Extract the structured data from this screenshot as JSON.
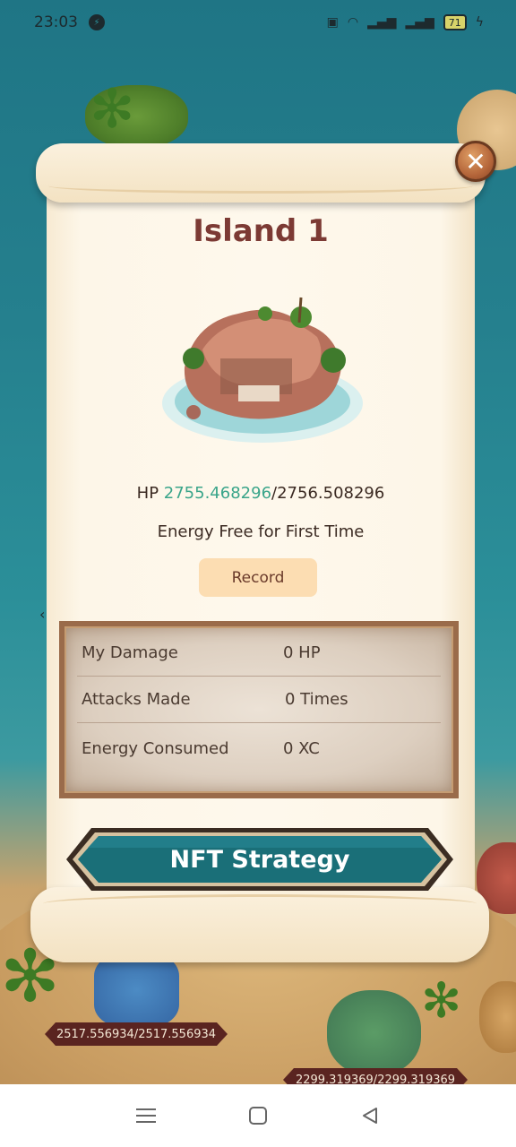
{
  "status_bar": {
    "time": "23:03",
    "battery": "71"
  },
  "dialog": {
    "title": "Island 1",
    "hp_label": "HP",
    "hp_current": "2755.468296",
    "hp_max": "/2756.508296",
    "energy_note": "Energy Free for First Time",
    "record_label": "Record",
    "stats": [
      {
        "label": "My Damage",
        "value": "0 HP"
      },
      {
        "label": "Attacks Made",
        "value": "0 Times"
      },
      {
        "label": "Energy Consumed",
        "value": "0 XC"
      }
    ],
    "primary_button": "NFT Strategy"
  },
  "background": {
    "island_hp_tags": [
      "2517.556934/2517.556934",
      "2299.319369/2299.319369"
    ]
  },
  "colors": {
    "title": "#7c3a34",
    "hp_current": "#3aa58a",
    "button_teal": "#1a6f78",
    "record_bg": "#fcddb2"
  }
}
